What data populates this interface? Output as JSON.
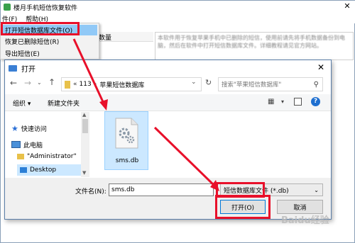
{
  "app": {
    "title": "楼月手机短信恢复软件",
    "menu_file": "件(F)",
    "menu_help": "帮助(H)",
    "column_header": "数量",
    "dropdown_items": [
      "打开短信数据库文件(O)",
      "恢复已删除短信(R)",
      "导出短信(E)"
    ],
    "info_text": "本软件用于恢复苹果手机中已删除的短信，使用前请先将手机数据备份到电脑，然后在软件中打开短信数据库文件。详细教程请见官方网站。"
  },
  "dialog": {
    "title": "打开",
    "breadcrumb": [
      "«",
      "113",
      "苹果短信数据库"
    ],
    "search_placeholder": "搜索\"苹果短信数据库\"",
    "toolbar_organize": "组织 ▾",
    "toolbar_new_folder": "新建文件夹",
    "nav": {
      "quick_access": "快速访问",
      "this_pc": "此电脑",
      "administrator": "\"Administrator\"",
      "desktop": "Desktop"
    },
    "file": {
      "name": "sms.db"
    },
    "filename_label": "文件名(N):",
    "filename_value": "sms.db",
    "filetype_value": "短信数据库文件 (*.db)",
    "open_button": "打开(O)",
    "cancel_button": "取消"
  },
  "watermark": "Baidu经验",
  "colors": {
    "highlight_red": "#e8102a",
    "selection_blue": "#cce8ff",
    "menu_highlight": "#91c9f7"
  }
}
